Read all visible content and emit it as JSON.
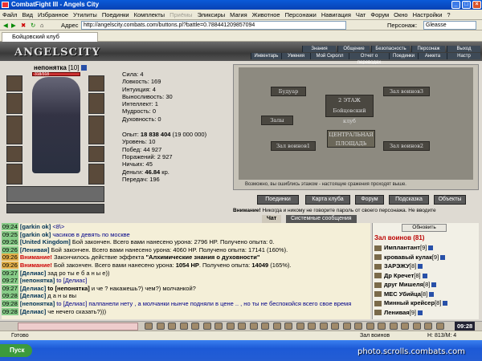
{
  "window": {
    "title": "CombatFight III - Angels City"
  },
  "menu": [
    "Файл",
    "Вид",
    "Избранное",
    "Утилиты",
    "Поединки",
    "Комплекты",
    "Приёмы",
    "Эликсиры",
    "Магия",
    "Животное",
    "Персонажи",
    "Навигация",
    "Чат",
    "Форум",
    "Окно",
    "Настройки",
    "?"
  ],
  "addressbar": {
    "label": "Адрес",
    "url": "http://angelscity.combats.com/buttons.pl?battle=0.788441209857094",
    "person_label": "Персонаж:",
    "person_value": "Gleasse"
  },
  "tab": {
    "label": "Бойцовский клуб"
  },
  "logo": "ANGELSCITY",
  "topnav_row1": [
    "Знания",
    "Общение",
    "Безопасность",
    "Персонаж",
    "Выход"
  ],
  "topnav_row2": [
    "Инвентарь",
    "Умения",
    "Мой Скролл",
    "Отчет о переводах",
    "Поединки",
    "Анкета",
    "Настр"
  ],
  "character": {
    "name": "непонятка",
    "level": "[10]",
    "hp": "318/318"
  },
  "stats": [
    {
      "label": "Сила:",
      "value": "4"
    },
    {
      "label": "Ловкость:",
      "value": "169"
    },
    {
      "label": "Интуиция:",
      "value": "4"
    },
    {
      "label": "Выносливость:",
      "value": "30"
    },
    {
      "label": "Интеллект:",
      "value": "1"
    },
    {
      "label": "Мудрость:",
      "value": "0"
    },
    {
      "label": "Духовность:",
      "value": "0"
    }
  ],
  "stats2": {
    "exp_label": "Опыт:",
    "exp_value": "18 838 404",
    "exp_next": "(19 000 000)",
    "level": "Уровень: 10",
    "wins": "Побед: 44 927",
    "losses": "Поражений: 2 927",
    "draws": "Ничьих: 45",
    "money_label": "Деньги:",
    "money_value": "46.84",
    "money_unit": "кр.",
    "transfers": "Передач: 196"
  },
  "map": {
    "floor": "2 ЭТАЖ",
    "club": "Бойцовский клуб",
    "square": "ЦЕНТРАЛЬНАЯ ПЛОЩАДЬ",
    "rooms": [
      "Будуар",
      "Зал воинов3",
      "Залы",
      "Зал воинов1",
      "Зал воинов2"
    ],
    "warning": "Возможно, вы ошиблись этажом - настоящие сражения проходят выше."
  },
  "actions": [
    "Поединки",
    "Карта клуба",
    "Форум",
    "Подсказка",
    "Объекты"
  ],
  "notice_label": "Внимание!",
  "notice": "Никогда и никому не говорите пароль от своего персонажа. Не вводите",
  "chat_tabs": [
    "Чат",
    "Системные сообщения"
  ],
  "chat": [
    {
      "time": "09:24",
      "hl": false,
      "parts": [
        {
          "c": "n",
          "t": "[garkin ok] "
        },
        {
          "c": "sys",
          "t": "<8\\>"
        }
      ]
    },
    {
      "time": "09:25",
      "hl": false,
      "parts": [
        {
          "c": "n",
          "t": "[garkin ok] "
        },
        {
          "c": "sys",
          "t": "часиков в девять по москве"
        }
      ]
    },
    {
      "time": "09:26",
      "hl": false,
      "parts": [
        {
          "c": "n",
          "t": "[United Kingdom] "
        },
        {
          "c": "",
          "t": "Бой закончен. Всего вами нанесено урона: 2796 HP. Получено опыта: 0."
        }
      ]
    },
    {
      "time": "09:26",
      "hl": false,
      "parts": [
        {
          "c": "n",
          "t": "[Ленивая] "
        },
        {
          "c": "",
          "t": "Бой закончен. Всего вами нанесено урона: 4060 HP. Получено опыта: 17141 (160%)."
        }
      ]
    },
    {
      "time": "09:26",
      "hl": true,
      "parts": [
        {
          "c": "warn",
          "t": "Внимание! "
        },
        {
          "c": "",
          "t": "Закончилось действие эффекта "
        },
        {
          "c": "bold",
          "t": "\"Алхимические знания о духовности\""
        }
      ]
    },
    {
      "time": "09:26",
      "hl": true,
      "parts": [
        {
          "c": "warn",
          "t": "Внимание! "
        },
        {
          "c": "",
          "t": "Бой закончен. Всего вами нанесено урона: "
        },
        {
          "c": "bold",
          "t": "1054 HP"
        },
        {
          "c": "",
          "t": ". Получено опыта: "
        },
        {
          "c": "bold",
          "t": "14049"
        },
        {
          "c": "",
          "t": " (165%)."
        }
      ]
    },
    {
      "time": "09:27",
      "hl": false,
      "parts": [
        {
          "c": "n",
          "t": "[Делиас] "
        },
        {
          "c": "",
          "t": "зад ро ты е б а н ы е))"
        }
      ]
    },
    {
      "time": "09:27",
      "hl": false,
      "parts": [
        {
          "c": "n",
          "t": "[непонятка] "
        },
        {
          "c": "sys",
          "t": "to [Делиас]"
        }
      ]
    },
    {
      "time": "09:27",
      "hl": false,
      "parts": [
        {
          "c": "n",
          "t": "[Делиас] "
        },
        {
          "c": "bold",
          "t": "to [непонятка]"
        },
        {
          "c": "",
          "t": " и че ? накажешь?) чем?) молчанкой?"
        }
      ]
    },
    {
      "time": "09:28",
      "hl": false,
      "parts": [
        {
          "c": "n",
          "t": "[Делиас] "
        },
        {
          "c": "",
          "t": "д а н ы вы"
        }
      ]
    },
    {
      "time": "09:28",
      "hl": false,
      "parts": [
        {
          "c": "n",
          "t": "[непонятка] "
        },
        {
          "c": "sys",
          "t": "to [Делиас] палпанели нету , а молчанки нынче подняли в цене .. , но ты не беспокойся всего свое время"
        }
      ]
    },
    {
      "time": "09:28",
      "hl": false,
      "parts": [
        {
          "c": "n",
          "t": "[Делиас] "
        },
        {
          "c": "",
          "t": "че нечего сказать?)))"
        }
      ]
    }
  ],
  "roster": {
    "refresh": "Обновить",
    "title": "Зал воинов (81)",
    "players": [
      {
        "name": "Имплантант",
        "lvl": "[9]"
      },
      {
        "name": "кровавый кулак",
        "lvl": "[9]"
      },
      {
        "name": "ЗАРЭЖУ",
        "lvl": "[8]"
      },
      {
        "name": "Др Кречет",
        "lvl": "[8]"
      },
      {
        "name": "друг Мишеля",
        "lvl": "[8]"
      },
      {
        "name": "МЕС Убийца",
        "lvl": "[8]"
      },
      {
        "name": "Минный крейсер",
        "lvl": "[8]"
      },
      {
        "name": "Ленивая",
        "lvl": "[9]"
      }
    ]
  },
  "clock": "09:28",
  "status": {
    "ready": "Готово",
    "room": "Зал воинов",
    "people": "Н: 813/М: 4"
  },
  "taskbar": {
    "start": "Пуск"
  },
  "watermark": "photo.scrolls.combats.com"
}
